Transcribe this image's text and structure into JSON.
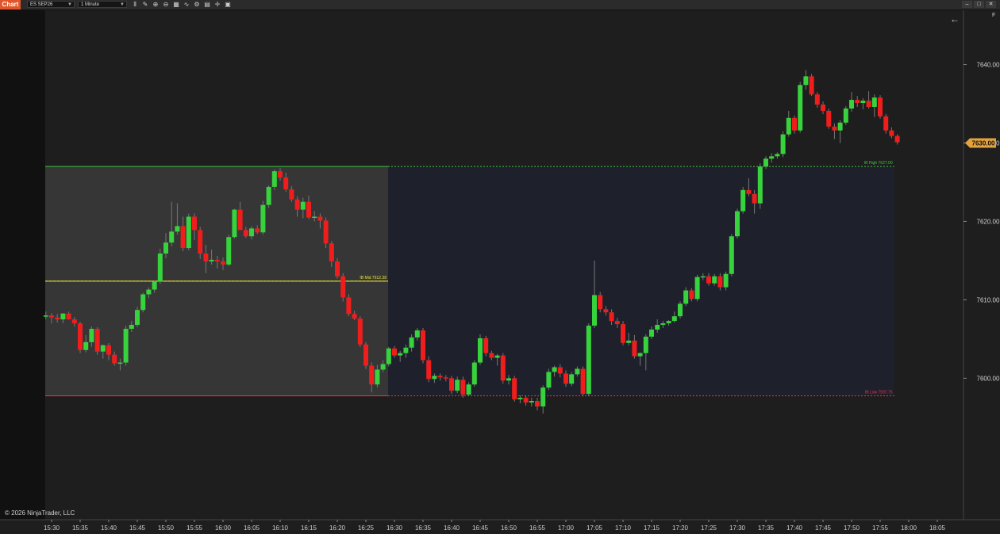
{
  "toolbar": {
    "chart_label": "Chart",
    "instrument": "ES SEP26",
    "interval": "1 Minute",
    "icons": [
      "bar-style-icon",
      "draw-tool-icon",
      "zoom-in-icon",
      "zoom-out-icon",
      "properties-icon",
      "indicators-icon",
      "strategies-icon",
      "templates-icon",
      "crosshair-icon",
      "data-box-icon"
    ],
    "window_buttons": [
      "minimize",
      "maximize",
      "close"
    ]
  },
  "copyright": "© 2026 NinjaTrader, LLC",
  "colors": {
    "background": "#1e1e1e",
    "up": "#37d33c",
    "down": "#f01d1d",
    "ib_high": "#3fc43f",
    "ib_mid": "#e9e430",
    "ib_low": "#e8344a",
    "session_box": "#363636",
    "extension_box": "#1e212b",
    "price_marker": "#e4a23c"
  },
  "chart_data": {
    "type": "candlestick",
    "x_ticks": [
      "15:30",
      "15:35",
      "15:40",
      "15:45",
      "15:50",
      "15:55",
      "16:00",
      "16:05",
      "16:10",
      "16:15",
      "16:20",
      "16:25",
      "16:30",
      "16:35",
      "16:40",
      "16:45",
      "16:50",
      "16:55",
      "17:00",
      "17:05",
      "17:10",
      "17:15",
      "17:20",
      "17:25",
      "17:30",
      "17:35",
      "17:40",
      "17:45",
      "17:50",
      "17:55",
      "18:00",
      "18:05"
    ],
    "y_ticks": [
      "7600.00",
      "7610.00",
      "7620.00",
      "7630.00",
      "7640.00"
    ],
    "ylim": [
      7587.0,
      7644.5
    ],
    "current_price": "7630.00",
    "levels": [
      {
        "name": "IB High",
        "price_label": "7627.00",
        "value": 7627.0
      },
      {
        "name": "IB Mid",
        "price_label": "7612.38",
        "value": 7612.38
      },
      {
        "name": "IB Low",
        "price_label": "7597.75",
        "value": 7597.75
      }
    ],
    "ib_window": {
      "start": "15:30",
      "end": "16:30"
    },
    "candles": [
      [
        "15:29",
        7608,
        7608.5,
        7607.5,
        7608
      ],
      [
        "15:30",
        7608,
        7608.3,
        7607,
        7607.75
      ],
      [
        "15:31",
        7607.75,
        7608.2,
        7607.1,
        7607.5
      ],
      [
        "15:32",
        7607.5,
        7608.3,
        7607,
        7608.25
      ],
      [
        "15:33",
        7608.25,
        7608.5,
        7607.5,
        7607.5
      ],
      [
        "15:34",
        7607.5,
        7607.8,
        7606.6,
        7607
      ],
      [
        "15:35",
        7607,
        7607.2,
        7603.2,
        7603.6
      ],
      [
        "15:36",
        7603.6,
        7605.5,
        7603.3,
        7604.6
      ],
      [
        "15:37",
        7604.6,
        7606.6,
        7604,
        7606.3
      ],
      [
        "15:38",
        7606.3,
        7606.5,
        7603,
        7603.4
      ],
      [
        "15:39",
        7603.4,
        7604.3,
        7602.5,
        7604.2
      ],
      [
        "15:40",
        7604.2,
        7604.5,
        7602.3,
        7603
      ],
      [
        "15:41",
        7603,
        7603.4,
        7601.6,
        7601.9
      ],
      [
        "15:42",
        7601.9,
        7602.5,
        7601,
        7602
      ],
      [
        "15:43",
        7602,
        7606.7,
        7601.6,
        7606.3
      ],
      [
        "15:44",
        7606.3,
        7607.3,
        7605.9,
        7606.8
      ],
      [
        "15:45",
        7606.8,
        7609.1,
        7606.5,
        7608.7
      ],
      [
        "15:46",
        7608.7,
        7610.9,
        7608.4,
        7610.7
      ],
      [
        "15:47",
        7610.7,
        7611.6,
        7610.2,
        7611.3
      ],
      [
        "15:48",
        7611.3,
        7612.5,
        7610.9,
        7612.3
      ],
      [
        "15:49",
        7612.3,
        7616.5,
        7612,
        7615.9
      ],
      [
        "15:50",
        7615.9,
        7618.5,
        7615.3,
        7617.3
      ],
      [
        "15:51",
        7617.3,
        7622.5,
        7616.8,
        7618.7
      ],
      [
        "15:52",
        7618.7,
        7622.3,
        7618.3,
        7619.4
      ],
      [
        "15:53",
        7619.4,
        7620.6,
        7616.2,
        7616.6
      ],
      [
        "15:54",
        7616.6,
        7621,
        7616.3,
        7620.6
      ],
      [
        "15:55",
        7620.6,
        7621,
        7617.6,
        7618.9
      ],
      [
        "15:56",
        7618.9,
        7619.3,
        7615.2,
        7615.9
      ],
      [
        "15:57",
        7615.9,
        7617,
        7613.4,
        7614.9
      ],
      [
        "15:58",
        7614.9,
        7616.4,
        7614.5,
        7615.1
      ],
      [
        "15:59",
        7615.1,
        7615.6,
        7614,
        7614.9
      ],
      [
        "16:00",
        7614.9,
        7615.4,
        7613.8,
        7614.5
      ],
      [
        "16:01",
        7614.5,
        7618.3,
        7614.3,
        7618
      ],
      [
        "16:02",
        7618,
        7621.6,
        7617.8,
        7621.5
      ],
      [
        "16:03",
        7621.5,
        7622.5,
        7618.9,
        7618.9
      ],
      [
        "16:04",
        7618.9,
        7619.3,
        7617.9,
        7618.1
      ],
      [
        "16:05",
        7618.1,
        7619.4,
        7617.7,
        7619.1
      ],
      [
        "16:06",
        7619.1,
        7619.5,
        7618.4,
        7618.6
      ],
      [
        "16:07",
        7618.6,
        7622.6,
        7618.3,
        7622.1
      ],
      [
        "16:08",
        7622.1,
        7624.6,
        7621.7,
        7624.4
      ],
      [
        "16:09",
        7624.4,
        7626.6,
        7624,
        7626.4
      ],
      [
        "16:10",
        7626.4,
        7626.8,
        7625.2,
        7625.6
      ],
      [
        "16:11",
        7625.6,
        7626.2,
        7623.8,
        7624.1
      ],
      [
        "16:12",
        7624.1,
        7624.5,
        7622.5,
        7622.8
      ],
      [
        "16:13",
        7622.8,
        7623.2,
        7620.6,
        7621.5
      ],
      [
        "16:14",
        7621.5,
        7623,
        7620.4,
        7622.5
      ],
      [
        "16:15",
        7622.5,
        7623.3,
        7620.3,
        7620.5
      ],
      [
        "16:16",
        7620.5,
        7621.3,
        7620,
        7620.6
      ],
      [
        "16:17",
        7620.6,
        7621,
        7619.1,
        7620.1
      ],
      [
        "16:18",
        7620.1,
        7620.5,
        7616.6,
        7617.2
      ],
      [
        "16:19",
        7617.2,
        7617.5,
        7614.2,
        7614.9
      ],
      [
        "16:20",
        7614.9,
        7615.3,
        7612.7,
        7613
      ],
      [
        "16:21",
        7613,
        7613.4,
        7609.8,
        7610.3
      ],
      [
        "16:22",
        7610.3,
        7610.7,
        7607.9,
        7608.2
      ],
      [
        "16:23",
        7608.2,
        7608.6,
        7607.4,
        7607.6
      ],
      [
        "16:24",
        7607.6,
        7607.9,
        7604,
        7604.3
      ],
      [
        "16:25",
        7604.3,
        7604.6,
        7601.2,
        7601.6
      ],
      [
        "16:26",
        7601.6,
        7602,
        7598.2,
        7599.2
      ],
      [
        "16:27",
        7599.2,
        7601.7,
        7598.8,
        7601.1
      ],
      [
        "16:28",
        7601.1,
        7602.3,
        7600.8,
        7601.8
      ],
      [
        "16:29",
        7601.8,
        7604,
        7601.5,
        7603.8
      ],
      [
        "16:30",
        7603.8,
        7604.1,
        7602.6,
        7602.9
      ],
      [
        "16:31",
        7602.9,
        7603.5,
        7602.1,
        7603.2
      ],
      [
        "16:32",
        7603.2,
        7604.3,
        7602.6,
        7603.9
      ],
      [
        "16:33",
        7603.9,
        7605.6,
        7603.4,
        7605.2
      ],
      [
        "16:34",
        7605.2,
        7606.4,
        7604.8,
        7606.1
      ],
      [
        "16:35",
        7606.1,
        7606.4,
        7601.9,
        7602.3
      ],
      [
        "16:36",
        7602.3,
        7602.8,
        7599.5,
        7599.9
      ],
      [
        "16:37",
        7599.9,
        7600.6,
        7599.4,
        7600.3
      ],
      [
        "16:38",
        7600.3,
        7600.6,
        7599.7,
        7600.1
      ],
      [
        "16:39",
        7600.1,
        7600.4,
        7599.6,
        7600
      ],
      [
        "16:40",
        7600,
        7600.3,
        7598,
        7598.4
      ],
      [
        "16:41",
        7598.4,
        7600.2,
        7598.1,
        7599.8
      ],
      [
        "16:42",
        7599.8,
        7600.2,
        7597.5,
        7597.9
      ],
      [
        "16:43",
        7597.9,
        7599.5,
        7597.7,
        7599.2
      ],
      [
        "16:44",
        7599.2,
        7602.3,
        7598.9,
        7602
      ],
      [
        "16:45",
        7602,
        7605.6,
        7601.7,
        7605.1
      ],
      [
        "16:46",
        7605.1,
        7605.4,
        7602.8,
        7603.2
      ],
      [
        "16:47",
        7603.2,
        7603.5,
        7602.3,
        7602.6
      ],
      [
        "16:48",
        7602.6,
        7603.1,
        7601.6,
        7602.9
      ],
      [
        "16:49",
        7602.9,
        7603.2,
        7599.3,
        7599.7
      ],
      [
        "16:50",
        7599.7,
        7600.4,
        7599.2,
        7600
      ],
      [
        "16:51",
        7600,
        7600.3,
        7597,
        7597.3
      ],
      [
        "16:52",
        7597.3,
        7597.8,
        7596.8,
        7597.5
      ],
      [
        "16:53",
        7597.5,
        7597.8,
        7596.5,
        7596.9
      ],
      [
        "16:54",
        7596.9,
        7597.5,
        7596.4,
        7597.1
      ],
      [
        "16:55",
        7597.1,
        7597.5,
        7595.9,
        7596.4
      ],
      [
        "16:56",
        7596.4,
        7599.1,
        7595.5,
        7598.8
      ],
      [
        "16:57",
        7598.8,
        7601.2,
        7598.5,
        7600.8
      ],
      [
        "16:58",
        7600.8,
        7601.6,
        7600.2,
        7601.4
      ],
      [
        "16:59",
        7601.4,
        7601.8,
        7600.1,
        7600.6
      ],
      [
        "17:00",
        7600.6,
        7601,
        7598.9,
        7599.3
      ],
      [
        "17:01",
        7599.3,
        7600.8,
        7599,
        7600.5
      ],
      [
        "17:02",
        7600.5,
        7601.5,
        7600.2,
        7601.2
      ],
      [
        "17:03",
        7601.2,
        7601.5,
        7597.7,
        7598
      ],
      [
        "17:04",
        7598,
        7607,
        7597.7,
        7606.7
      ],
      [
        "17:05",
        7606.7,
        7615,
        7606.4,
        7610.6
      ],
      [
        "17:06",
        7610.6,
        7611,
        7608.4,
        7608.8
      ],
      [
        "17:07",
        7608.8,
        7609.2,
        7608,
        7608.4
      ],
      [
        "17:08",
        7608.4,
        7608.8,
        7606.8,
        7607.3
      ],
      [
        "17:09",
        7607.3,
        7607.7,
        7606.4,
        7606.9
      ],
      [
        "17:10",
        7606.9,
        7607.3,
        7604.2,
        7604.5
      ],
      [
        "17:11",
        7604.5,
        7605.8,
        7604.2,
        7604.8
      ],
      [
        "17:12",
        7604.8,
        7605.5,
        7602.5,
        7602.8
      ],
      [
        "17:13",
        7602.8,
        7603.3,
        7601.6,
        7603.2
      ],
      [
        "17:14",
        7603.2,
        7605.6,
        7601,
        7605.3
      ],
      [
        "17:15",
        7605.3,
        7606.6,
        7605,
        7606.2
      ],
      [
        "17:16",
        7606.2,
        7607.5,
        7605.8,
        7606.8
      ],
      [
        "17:17",
        7606.8,
        7607.3,
        7606.4,
        7607
      ],
      [
        "17:18",
        7607,
        7607.4,
        7606.7,
        7607.3
      ],
      [
        "17:19",
        7607.3,
        7608.5,
        7607.1,
        7607.9
      ],
      [
        "17:20",
        7607.9,
        7609.8,
        7607.6,
        7609.5
      ],
      [
        "17:21",
        7609.5,
        7611.6,
        7609.2,
        7611.2
      ],
      [
        "17:22",
        7611.2,
        7611.5,
        7609.8,
        7610.1
      ],
      [
        "17:23",
        7610.1,
        7613.2,
        7609.8,
        7612.9
      ],
      [
        "17:24",
        7612.9,
        7613.4,
        7612.5,
        7613
      ],
      [
        "17:25",
        7613,
        7613.4,
        7611.8,
        7612.1
      ],
      [
        "17:26",
        7612.1,
        7613.3,
        7611.8,
        7613
      ],
      [
        "17:27",
        7613,
        7613.4,
        7611.2,
        7611.6
      ],
      [
        "17:28",
        7611.6,
        7613.6,
        7611.2,
        7613.3
      ],
      [
        "17:29",
        7613.3,
        7618.4,
        7613,
        7618.1
      ],
      [
        "17:30",
        7618.1,
        7621.6,
        7617.8,
        7621.3
      ],
      [
        "17:31",
        7621.3,
        7624.4,
        7621,
        7624
      ],
      [
        "17:32",
        7624,
        7625.5,
        7623.2,
        7623.5
      ],
      [
        "17:33",
        7623.5,
        7624,
        7621,
        7622.3
      ],
      [
        "17:34",
        7622.3,
        7627.4,
        7621.6,
        7627
      ],
      [
        "17:35",
        7627,
        7628.3,
        7626.7,
        7628
      ],
      [
        "17:36",
        7628,
        7628.7,
        7627.5,
        7628.3
      ],
      [
        "17:37",
        7628.3,
        7628.8,
        7628,
        7628.6
      ],
      [
        "17:38",
        7628.6,
        7631.5,
        7628.2,
        7631.1
      ],
      [
        "17:39",
        7631.1,
        7634.1,
        7630.8,
        7633.2
      ],
      [
        "17:40",
        7633.2,
        7633.5,
        7631.2,
        7631.6
      ],
      [
        "17:41",
        7631.6,
        7637.8,
        7631.3,
        7637.4
      ],
      [
        "17:42",
        7637.4,
        7639.3,
        7636.8,
        7638.5
      ],
      [
        "17:43",
        7638.5,
        7638.8,
        7636,
        7636.2
      ],
      [
        "17:44",
        7636.2,
        7636.5,
        7634.5,
        7634.9
      ],
      [
        "17:45",
        7634.9,
        7635.3,
        7633.7,
        7634.1
      ],
      [
        "17:46",
        7634.1,
        7634.4,
        7631.8,
        7632.1
      ],
      [
        "17:47",
        7632.1,
        7632.5,
        7630.5,
        7631.6
      ],
      [
        "17:48",
        7631.6,
        7632.9,
        7630,
        7632.6
      ],
      [
        "17:49",
        7632.6,
        7634.7,
        7632.3,
        7634.4
      ],
      [
        "17:50",
        7634.4,
        7636.5,
        7634,
        7635.5
      ],
      [
        "17:51",
        7635.5,
        7636,
        7634.6,
        7635.1
      ],
      [
        "17:52",
        7635.1,
        7635.7,
        7634.3,
        7635.4
      ],
      [
        "17:53",
        7635.4,
        7636.6,
        7634.4,
        7634.6
      ],
      [
        "17:54",
        7634.6,
        7636.2,
        7633.3,
        7635.8
      ],
      [
        "17:55",
        7635.8,
        7636.1,
        7633.1,
        7633.4
      ],
      [
        "17:56",
        7633.4,
        7633.7,
        7631.2,
        7631.6
      ],
      [
        "17:57",
        7631.6,
        7632,
        7630.6,
        7630.9
      ],
      [
        "17:58",
        7630.9,
        7631.1,
        7629.8,
        7630.1
      ]
    ]
  }
}
